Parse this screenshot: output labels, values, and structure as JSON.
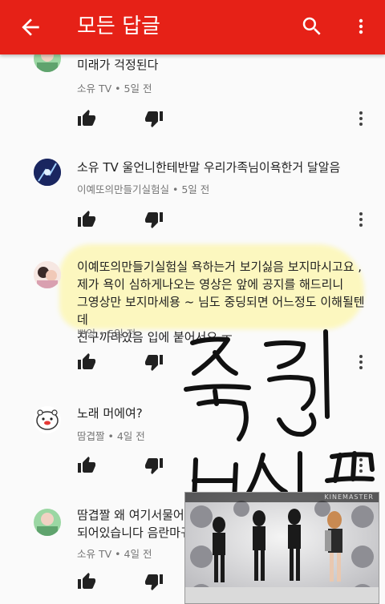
{
  "appbar": {
    "title": "모든 답글"
  },
  "comments": [
    {
      "text": "미래가 걱정된다",
      "author": "소유 TV",
      "time": "5일 전"
    },
    {
      "text": "소유 TV 울언니한테반말 우리가족님이욕한거 달알음",
      "author": "이예또의만들기실험실",
      "time": "5일 전"
    },
    {
      "text_lines": [
        "이예또의만들기실험실 욕하는거 보기싫음 보지마시고요 ,",
        "제가 욕이 심하게나오는 영상은 앞에 공지를 해드리니",
        "그영상만 보지마세용 ~ 님도 중딩되면 어느정도 이해될텐데",
        "친구끼리있음 입에 붙어서요 ㅜ"
      ],
      "author": "뽀잉",
      "time": "5일 전"
    },
    {
      "text": "노래 머에여?",
      "author": "땀겹짤",
      "time": "4일 전"
    },
    {
      "text_lines": [
        "땀겹짤 왜 여기서물어보",
        "되어있습니다 음란마귀"
      ],
      "author": "소유 TV",
      "time": "4일 전"
    }
  ],
  "separator": "•",
  "video_overlay": {
    "watermark": "KINEMASTER"
  },
  "colors": {
    "brand": "#e62117",
    "meta": "#757575",
    "highlight": "#fff478"
  },
  "icons": [
    "back-arrow-icon",
    "search-icon",
    "more-vert-icon",
    "thumb-up-icon",
    "thumb-down-icon",
    "more-vert-icon"
  ]
}
